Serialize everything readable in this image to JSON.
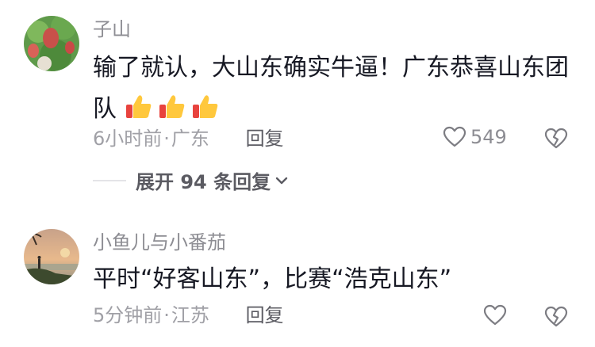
{
  "comments": [
    {
      "author": "子山",
      "text_lines": [
        "输了就认，大山东确实牛逼！广东恭喜山东团",
        "队"
      ],
      "time": "6小时前",
      "location": "广东",
      "reply_label": "回复",
      "likes": "549",
      "emoji": [
        "thumbs-up",
        "thumbs-up",
        "thumbs-up"
      ],
      "expand_label": "展开 94 条回复"
    },
    {
      "author": "小鱼儿与小番茄",
      "text": "平时“好客山东”，比赛“浩克山东”",
      "time": "5分钟前",
      "location": "江苏",
      "reply_label": "回复",
      "likes": ""
    }
  ],
  "separator": "·",
  "colors": {
    "author": "#8d8d93",
    "text": "#161823",
    "meta": "#a0a0a6",
    "reply": "#5b5b62"
  }
}
